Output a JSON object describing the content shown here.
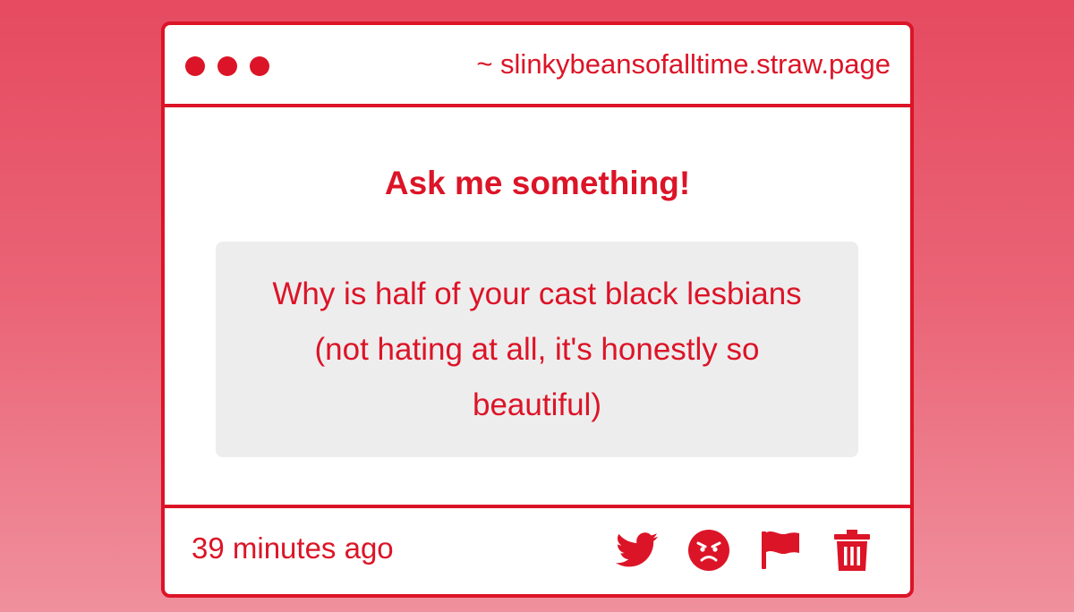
{
  "window": {
    "url": "~ slinkybeansofalltime.straw.page"
  },
  "main": {
    "title": "Ask me something!",
    "question": "Why is half of your cast black lesbians (not hating at all, it's honestly so beautiful)"
  },
  "footer": {
    "timestamp": "39 minutes ago",
    "actions": [
      {
        "icon": "twitter-icon"
      },
      {
        "icon": "angry-face-icon"
      },
      {
        "icon": "flag-icon"
      },
      {
        "icon": "trash-icon"
      }
    ]
  },
  "colors": {
    "accent": "#dc1427",
    "background_top": "#e64a60",
    "background_bottom": "#f0909d",
    "question_box": "#eeedee"
  }
}
